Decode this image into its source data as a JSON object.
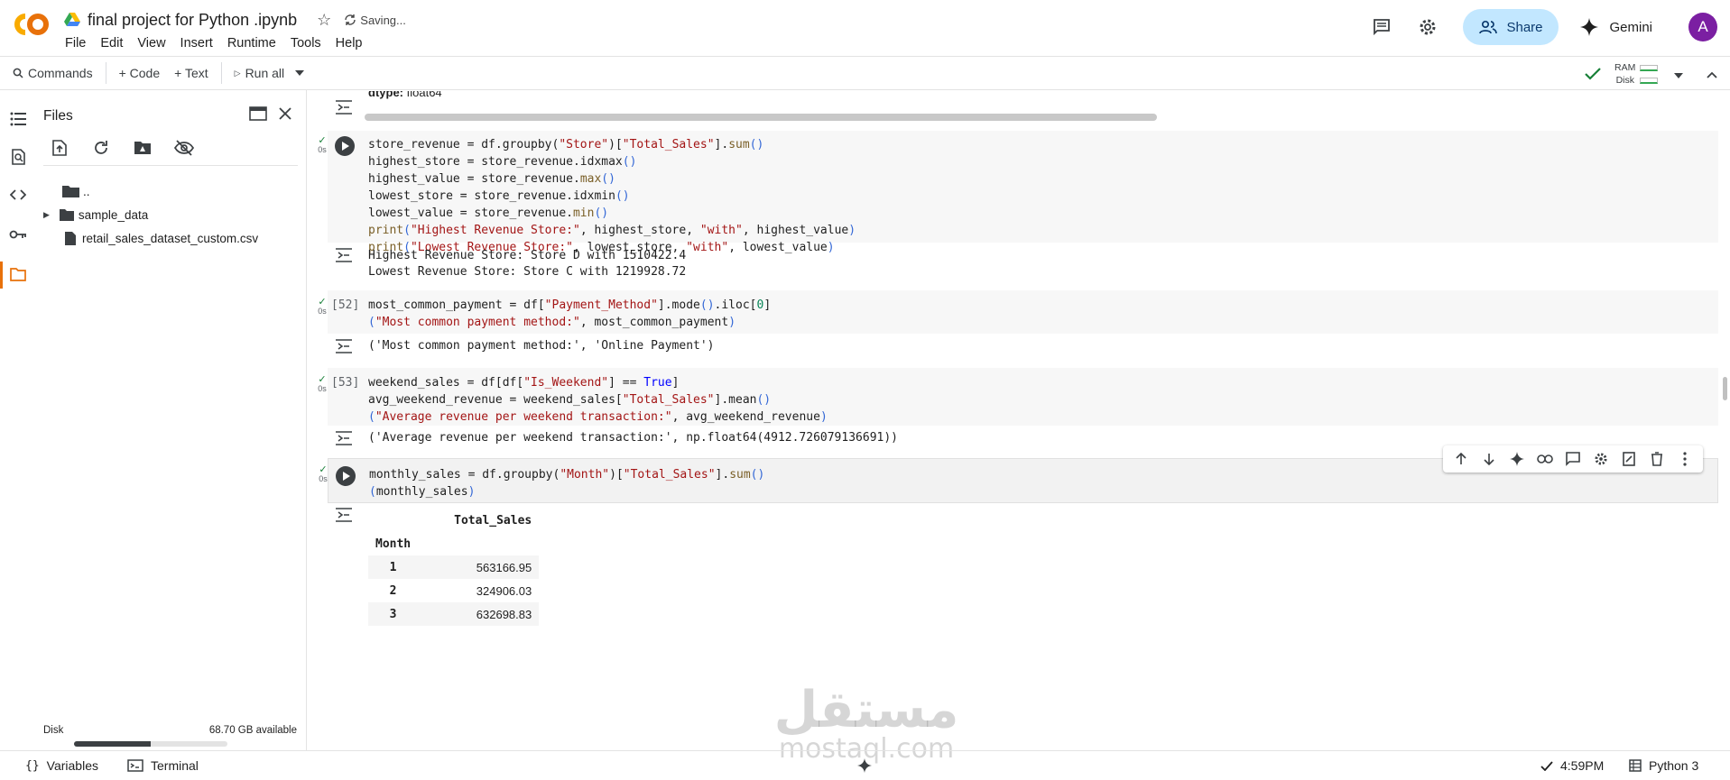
{
  "header": {
    "doc_title": "final project for Python .ipynb",
    "saving_text": "Saving...",
    "menus": [
      "File",
      "Edit",
      "View",
      "Insert",
      "Runtime",
      "Tools",
      "Help"
    ],
    "share_label": "Share",
    "gemini_label": "Gemini",
    "avatar_letter": "A"
  },
  "toolbar": {
    "commands_label": "Commands",
    "code_label": "+ Code",
    "text_label": "+ Text",
    "run_all_label": "Run all",
    "ram_label": "RAM",
    "disk_label": "Disk"
  },
  "files": {
    "title": "Files",
    "items": [
      "..",
      "sample_data",
      "retail_sales_dataset_custom.csv"
    ],
    "disk_label": "Disk",
    "disk_available": "68.70 GB available",
    "disk_used_fraction": 0.5
  },
  "cells": {
    "prev_output_label": "dtype:",
    "prev_output_value": "float64",
    "cell1": {
      "status": "0s",
      "output": [
        "Highest Revenue Store: Store D with 1510422.4",
        "Lowest Revenue Store: Store C with 1219928.72"
      ]
    },
    "cell2": {
      "exec": "[52]",
      "status": "0s",
      "output": "('Most common payment method:', 'Online Payment')"
    },
    "cell3": {
      "exec": "[53]",
      "status": "0s",
      "output": "('Average revenue per weekend transaction:', np.float64(4912.726079136691))"
    },
    "cell4": {
      "status": "0s",
      "table_header": "Total_Sales",
      "index_name": "Month",
      "rows": [
        {
          "month": "1",
          "value": "563166.95"
        },
        {
          "month": "2",
          "value": "324906.03"
        },
        {
          "month": "3",
          "value": "632698.83"
        }
      ]
    }
  },
  "statusbar": {
    "variables_label": "Variables",
    "terminal_label": "Terminal",
    "time": "4:59PM",
    "runtime": "Python 3"
  },
  "watermark": {
    "arabic": "مستقل",
    "latin": "mostaql.com"
  },
  "colors": {
    "accent_orange": "#e8710a",
    "share_bg": "#c2e7ff",
    "success_green": "#188038"
  }
}
